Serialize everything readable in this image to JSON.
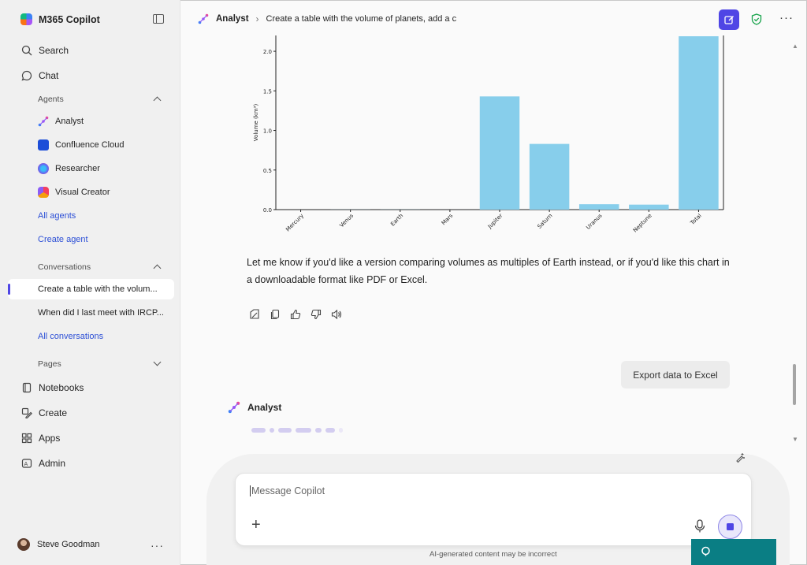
{
  "sidebar": {
    "app_title": "M365 Copilot",
    "search_label": "Search",
    "chat_label": "Chat",
    "agents_header": "Agents",
    "agents": [
      {
        "label": "Analyst",
        "icon": "analyst-icon"
      },
      {
        "label": "Confluence Cloud",
        "icon": "confluence-icon"
      },
      {
        "label": "Researcher",
        "icon": "researcher-icon"
      },
      {
        "label": "Visual Creator",
        "icon": "visual-creator-icon"
      }
    ],
    "all_agents": "All agents",
    "create_agent": "Create agent",
    "conversations_header": "Conversations",
    "conversations": [
      "Create a table with the volum...",
      "When did I last meet with IRCP..."
    ],
    "all_conversations": "All conversations",
    "pages_header": "Pages",
    "notebooks": "Notebooks",
    "create": "Create",
    "apps": "Apps",
    "admin": "Admin",
    "user_name": "Steve Goodman"
  },
  "header": {
    "agent_name": "Analyst",
    "conversation_title": "Create a table with the volume of planets, add a c",
    "accent": "#4f46e5"
  },
  "chart_data": {
    "type": "bar",
    "categories": [
      "Mercury",
      "Venus",
      "Earth",
      "Mars",
      "Jupiter",
      "Saturn",
      "Uranus",
      "Neptune",
      "Total"
    ],
    "values": [
      6.1e-06,
      0.00093,
      0.00108,
      0.00016,
      1.43,
      0.83,
      0.068,
      0.063,
      2.19
    ],
    "ylabel": "Volume (km³)",
    "yticks": [
      "0.0",
      "0.5",
      "1.0",
      "1.5",
      "2.0"
    ],
    "ylim": [
      0,
      2.2
    ],
    "bar_color": "#87ceeb"
  },
  "message": {
    "text": "Let me know if you'd like a version comparing volumes as multiples of Earth instead, or if you'd like this chart in a downloadable format like PDF or Excel."
  },
  "suggestion": "Export data to Excel",
  "responding_agent": "Analyst",
  "composer": {
    "placeholder": "Message Copilot"
  },
  "disclaimer": "AI-generated content may be incorrect"
}
